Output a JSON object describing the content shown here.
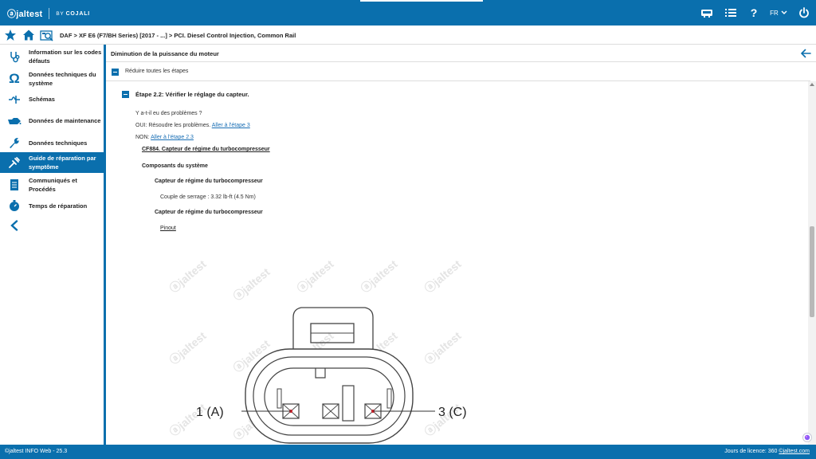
{
  "app": {
    "logo_text": "ⓐjaltest",
    "by_text": "BY",
    "by_brand": "COJALI",
    "language": "FR"
  },
  "breadcrumb": "DAF > XF E6 (F7/BH Series) [2017 - ...] > PCI. Diesel Control Injection, Common Rail",
  "sidebar": {
    "items": [
      {
        "label": "Information sur les codes défauts",
        "icon": "stethoscope-icon"
      },
      {
        "label": "Données techniques du système",
        "icon": "omega-icon"
      },
      {
        "label": "Schémas",
        "icon": "schematic-icon"
      },
      {
        "label": "Données de maintenance",
        "icon": "oil-can-icon"
      },
      {
        "label": "Données techniques",
        "icon": "wrench-icon"
      },
      {
        "label": "Guide de réparation par symptôme",
        "icon": "repair-guide-icon"
      },
      {
        "label": "Communiqués et Procédés",
        "icon": "document-icon"
      },
      {
        "label": "Temps de réparation",
        "icon": "stopwatch-icon"
      }
    ],
    "active_index": 5
  },
  "content": {
    "section_title": "Diminution de la puissance du moteur",
    "collapse_all_label": "Réduire toutes les étapes",
    "step_title": "Étape 2.2: Vérifier le réglage du capteur.",
    "question": "Y a-t-il eu des problèmes ?",
    "yes_prefix": "OUI: Résoudre les problèmes. ",
    "yes_link": "Aller à l'étape 3",
    "no_prefix": "NON: ",
    "no_link": "Aller à l'étape 2.3",
    "component_link": "CF884. Capteur de régime du turbocompresseur",
    "components_heading": "Composants du système",
    "sensor_heading_1": "Capteur de régime du turbocompresseur",
    "torque_text": "Couple de serrage : 3.32 lb-ft (4.5 Nm)",
    "sensor_heading_2": "Capteur de régime du turbocompresseur",
    "pinout_link": "Pinout"
  },
  "diagram": {
    "label_left": "1 (A)",
    "label_right": "3 (C)",
    "watermark": "ⓐjaltest"
  },
  "footer": {
    "left": "©jaltest INFO Web - 25.3",
    "license_text": "Jours de licence: 360",
    "site_link": "©jaltest.com"
  },
  "colors": {
    "primary": "#0a6fad",
    "link": "#1a6fb5",
    "pin_dot": "#d0202a"
  }
}
